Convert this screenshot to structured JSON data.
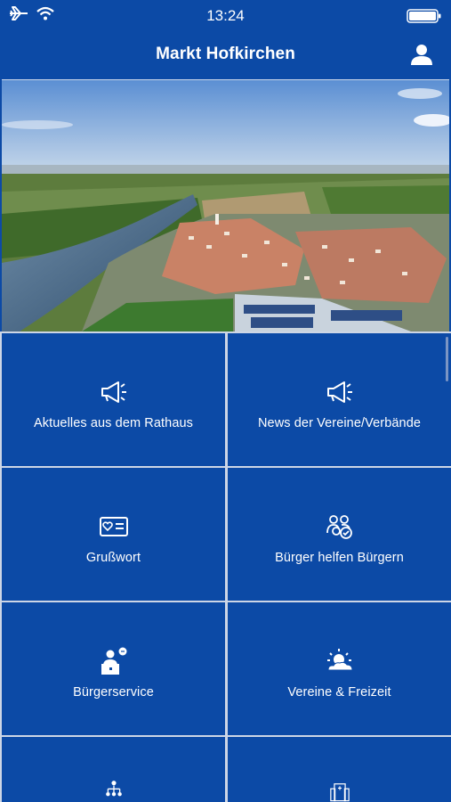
{
  "status_bar": {
    "time": "13:24"
  },
  "nav": {
    "title": "Markt Hofkirchen"
  },
  "tiles": [
    {
      "label": "Aktuelles aus dem Rathaus"
    },
    {
      "label": "News der Vereine/Verbände"
    },
    {
      "label": "Grußwort"
    },
    {
      "label": "Bürger helfen Bürgern"
    },
    {
      "label": "Bürgerservice"
    },
    {
      "label": "Vereine & Freizeit"
    },
    {
      "label": ""
    },
    {
      "label": ""
    }
  ],
  "colors": {
    "primary": "#0c4aa6",
    "divider": "#cdd6e6"
  }
}
